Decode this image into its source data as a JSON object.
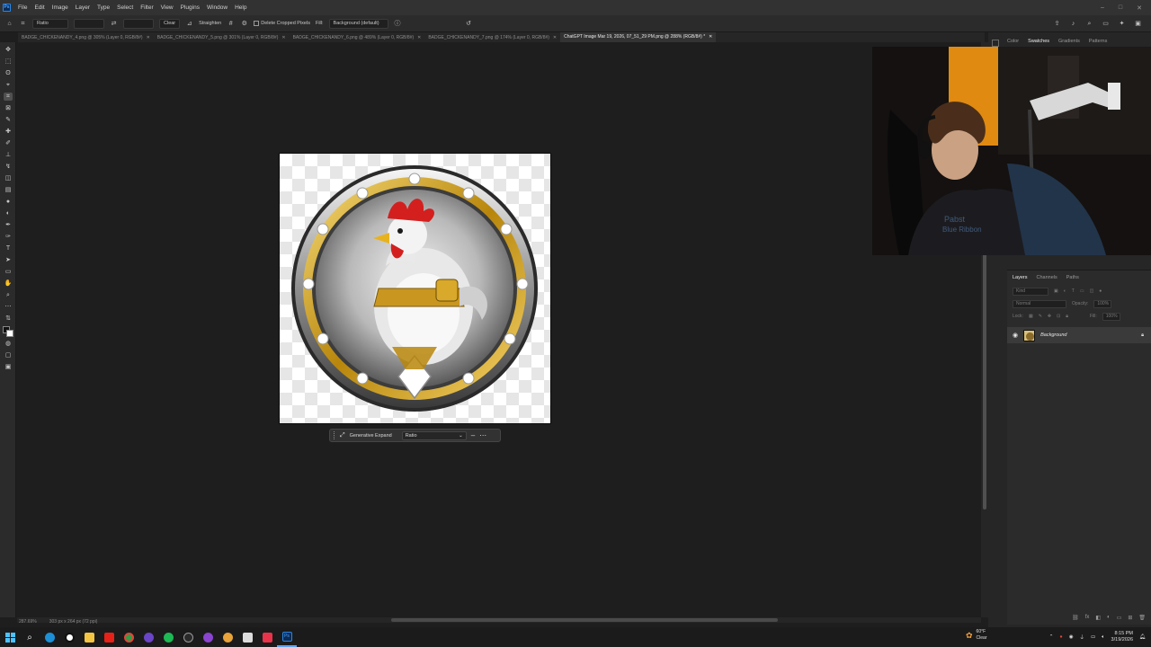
{
  "menu": {
    "items": [
      "File",
      "Edit",
      "Image",
      "Layer",
      "Type",
      "Select",
      "Filter",
      "View",
      "Plugins",
      "Window",
      "Help"
    ],
    "window_controls": [
      "–",
      "□",
      "✕"
    ]
  },
  "options_bar": {
    "ratio_label": "Ratio",
    "clear_label": "Clear",
    "straighten_label": "Straighten",
    "delete_cropped_label": "Delete Cropped Pixels",
    "fill_label": "Fill:",
    "fill_value": "Background (default)"
  },
  "tabs": [
    {
      "title": "BADGE_CHICKENANDY_4.png @ 305% (Layer 0, RGB/8#)",
      "active": false
    },
    {
      "title": "BADGE_CHICKENANDY_5.png @ 301% (Layer 0, RGB/8#)",
      "active": false
    },
    {
      "title": "BADGE_CHICKENANDY_6.png @ 489% (Layer 0, RGB/8#)",
      "active": false
    },
    {
      "title": "BADGE_CHICKENANDY_7.png @ 174% (Layer 0, RGB/8#)",
      "active": false
    },
    {
      "title": "ChatGPT Image Mar 19, 2026, 07_51_29 PM.png @ 288% (RGB/8#) *",
      "active": true
    }
  ],
  "contextual_bar": {
    "generative_expand_label": "Generative Expand",
    "ratio_value": "Ratio"
  },
  "status_bar": {
    "zoom": "287.69%",
    "doc_info": "303 px x 264 px (72 ppi)"
  },
  "top_panel_tabs": [
    "Color",
    "Swatches",
    "Gradients",
    "Patterns"
  ],
  "top_panel_active": "Swatches",
  "layers_panel": {
    "tabs": [
      "Layers",
      "Channels",
      "Paths"
    ],
    "active_tab": "Layers",
    "search_placeholder": "Kind",
    "blend_mode": "Normal",
    "opacity_label": "Opacity:",
    "opacity_value": "100%",
    "lock_label": "Lock:",
    "fill_label": "Fill:",
    "fill_value": "100%",
    "layers": [
      {
        "name": "Background",
        "visible": true,
        "locked": true
      }
    ]
  },
  "taskbar": {
    "weather_temp": "60°F",
    "weather_desc": "Clear",
    "time": "8:15 PM",
    "date": "3/19/2026"
  },
  "colors": {
    "accent": "#5aa1ff",
    "app_bg": "#1e1e1e",
    "panel_bg": "#2b2b2b"
  }
}
